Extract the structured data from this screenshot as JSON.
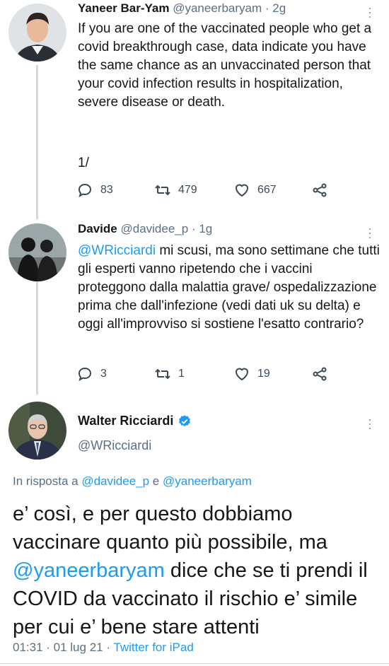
{
  "tweets": [
    {
      "name": "Yaneer Bar-Yam",
      "handle": "@yaneerbaryam",
      "time": "· 2g",
      "text": "If you are one of the vaccinated people who get a covid breakthrough case, data indicate you have the same chance as an unvaccinated person that your covid infection results in hospitalization, severe disease or death.",
      "thread_marker": "1/",
      "replies": "83",
      "retweets": "479",
      "likes": "667"
    },
    {
      "name": "Davide",
      "handle": "@davidee_p",
      "time": "· 1g",
      "mention": "@WRicciardi",
      "text": " mi scusi, ma sono settimane che tutti gli esperti vanno ripetendo che i vaccini proteggono dalla malattia grave/ ospedalizzazione prima che dall'infezione (vedi dati uk su delta) e oggi all'improvviso si sostiene l'esatto contrario?",
      "replies": "3",
      "retweets": "1",
      "likes": "19"
    }
  ],
  "main": {
    "name": "Walter Ricciardi",
    "handle": "@WRicciardi",
    "reply_prefix": "In risposta a",
    "reply_mention_1": "@davidee_p",
    "reply_and": "e",
    "reply_mention_2": "@yaneerbaryam",
    "text_part1": "e’ così, e per questo dobbiamo vaccinare quanto più possibile, ma",
    "text_mention": "@yaneerbaryam",
    "text_part2": "dice che se ti prendi il COVID da vaccinato il rischio e’ simile per cui e’ bene stare attenti",
    "time": "01:31 · 01 lug 21 ·",
    "source": "Twitter for iPad"
  },
  "icons": {
    "reply": "reply-icon",
    "retweet": "retweet-icon",
    "like": "heart-icon",
    "share": "share-icon",
    "verified": "verified-badge-icon",
    "more": "more-dots-icon"
  },
  "colors": {
    "accent": "#1d9bf0",
    "secondary_text": "#5b7083",
    "thread_line": "#cfd9de"
  }
}
